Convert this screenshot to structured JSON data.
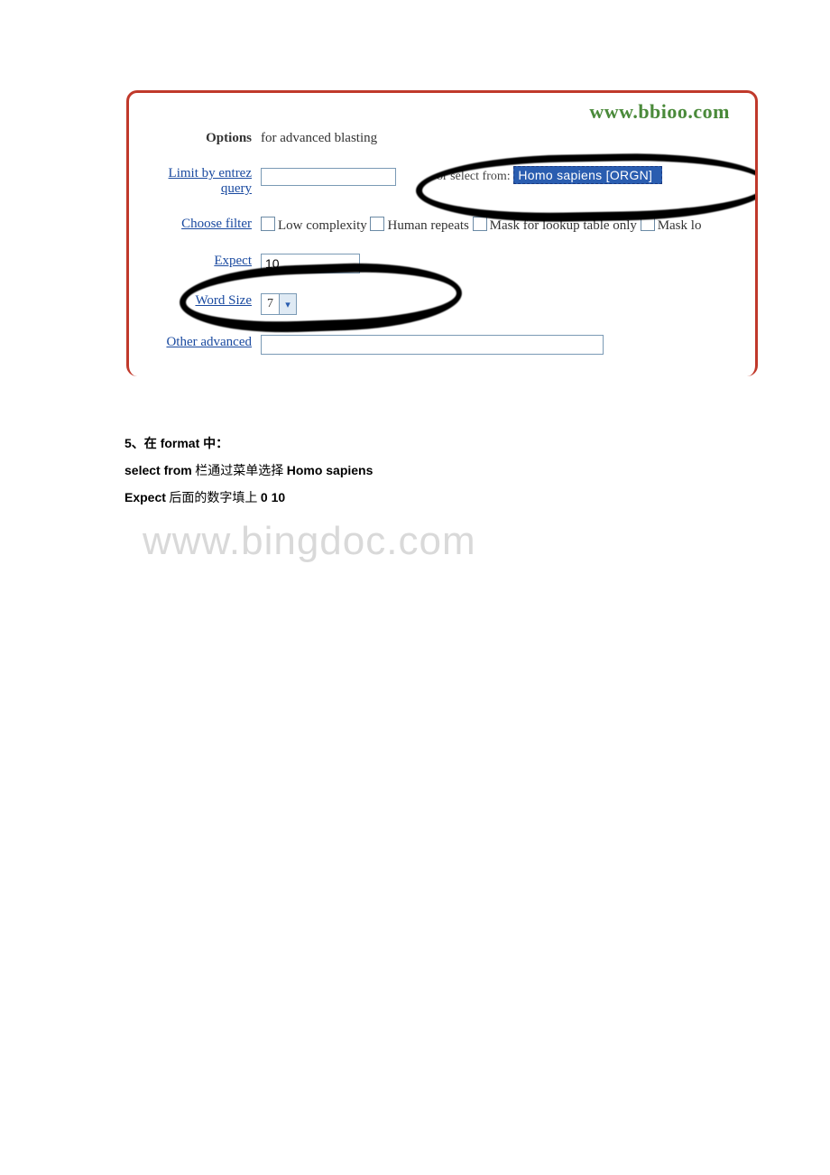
{
  "watermark_top": "www.bbioo.com",
  "options": {
    "label_bold": "Options",
    "label_rest": " for advanced blasting"
  },
  "entrez": {
    "label": "Limit by entrez query",
    "select_from_label": "or select from:",
    "select_from_value": "Homo sapiens [ORGN]"
  },
  "filter": {
    "label": "Choose filter",
    "opt1": "Low complexity",
    "opt2": "Human repeats",
    "opt3": "Mask for lookup table only",
    "opt4": "Mask lo"
  },
  "expect": {
    "label": "Expect",
    "value": "10"
  },
  "wordsize": {
    "label": "Word Size",
    "value": "7"
  },
  "other": {
    "label": "Other advanced"
  },
  "instr": {
    "line1_prefix": "5、在 ",
    "line1_bold": "format",
    "line1_suffix": " 中：",
    "line2_bold1": "select from",
    "line2_mid": " 栏通过菜单选择 ",
    "line2_bold2": "Homo sapiens",
    "line3_bold1": "Expect",
    "line3_mid": " 后面的数字填上 ",
    "line3_bold2": "0 10"
  },
  "big_watermark": "www.bingdoc.com"
}
